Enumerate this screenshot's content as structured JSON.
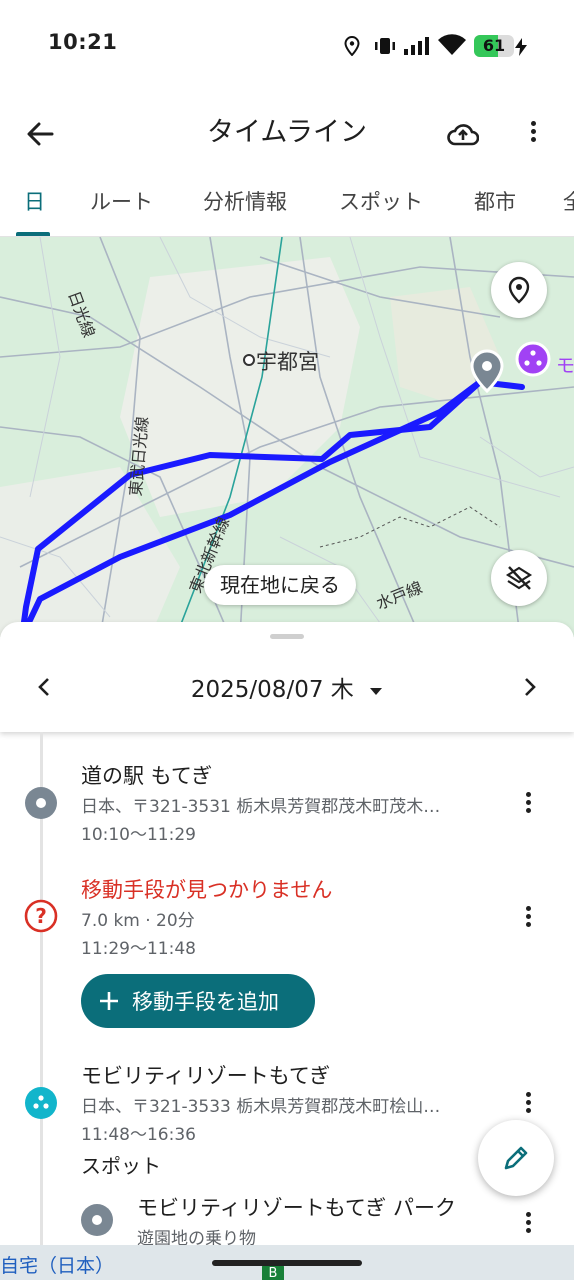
{
  "status_bar": {
    "time": "10:21",
    "battery": "61",
    "battery_level_pct": 61
  },
  "app_bar": {
    "title": "タイムライン"
  },
  "tabs": [
    {
      "label": "日",
      "active": true
    },
    {
      "label": "ルート"
    },
    {
      "label": "分析情報"
    },
    {
      "label": "スポット"
    },
    {
      "label": "都市"
    },
    {
      "label": "全"
    }
  ],
  "map": {
    "labels": {
      "utsunomiya": "宇都宮",
      "nikko_line": "日光線",
      "tobu_nikko_line": "東武日光線",
      "tohoku_shinkansen": "東北新幹線",
      "mito_line": "水戸線",
      "partial_place": "モ"
    },
    "return_button": "現在地に戻る",
    "colors": {
      "route": "#1a1aff",
      "land": "#d9eedc",
      "place_purple": "#a142f4"
    }
  },
  "date_nav": {
    "date": "2025/08/07 木"
  },
  "timeline": {
    "visit1": {
      "title": "道の駅 もてぎ",
      "address": "日本、〒321-3531 栃木県芳賀郡茂木町茂木…",
      "time": "10:10〜11:29"
    },
    "missing": {
      "title": "移動手段が見つかりません",
      "detail": "7.0 km · 20分",
      "time": "11:29〜11:48"
    },
    "add_button": "移動手段を追加",
    "visit2": {
      "title": "モビリティリゾートもてぎ",
      "address": "日本、〒321-3533 栃木県芳賀郡茂木町桧山…",
      "time": "11:48〜16:36"
    },
    "section_label": "スポット",
    "sub_visit": {
      "title": "モビリティリゾートもてぎ パーク",
      "category": "遊園地の乗り物"
    },
    "accent": "#0b6e7a",
    "alert_color": "#d93025"
  },
  "bottom_map": {
    "label": "自宅（日本）",
    "partial": "B"
  }
}
